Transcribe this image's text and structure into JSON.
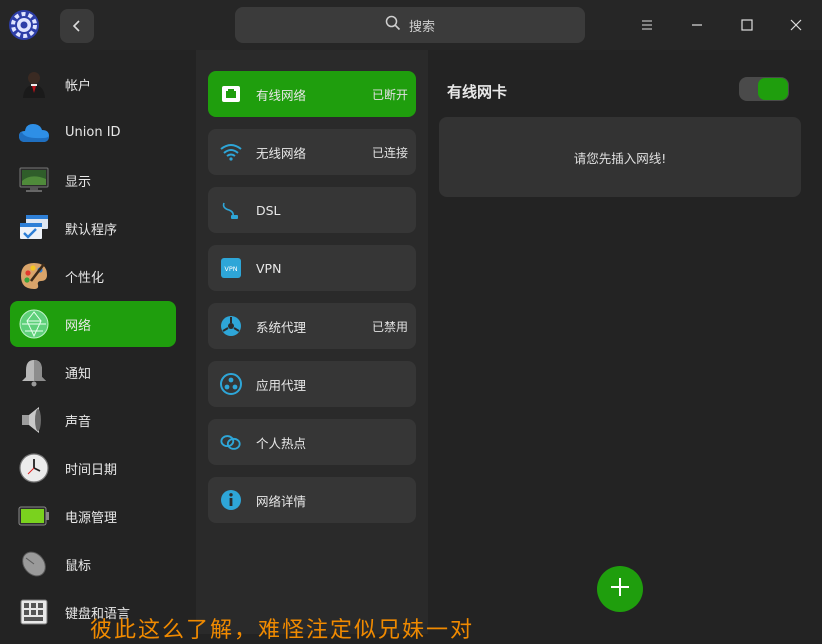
{
  "window": {
    "search_placeholder": "搜索",
    "icons": {
      "logo": "gear-icon",
      "back": "chevron-left-icon",
      "menu": "menu-icon",
      "minimize": "minimize-icon",
      "maximize": "maximize-icon",
      "close": "close-icon"
    }
  },
  "sidebar": {
    "items": [
      {
        "label": "帐户",
        "icon": "user-avatar-icon"
      },
      {
        "label": "Union ID",
        "icon": "cloud-icon"
      },
      {
        "label": "显示",
        "icon": "monitor-icon"
      },
      {
        "label": "默认程序",
        "icon": "default-apps-icon"
      },
      {
        "label": "个性化",
        "icon": "palette-icon"
      },
      {
        "label": "网络",
        "icon": "network-globe-icon",
        "active": true
      },
      {
        "label": "通知",
        "icon": "bell-icon"
      },
      {
        "label": "声音",
        "icon": "speaker-icon"
      },
      {
        "label": "时间日期",
        "icon": "clock-icon"
      },
      {
        "label": "电源管理",
        "icon": "battery-icon"
      },
      {
        "label": "鼠标",
        "icon": "mouse-icon"
      },
      {
        "label": "键盘和语言",
        "icon": "keyboard-icon"
      }
    ]
  },
  "network_menu": {
    "items": [
      {
        "label": "有线网络",
        "status": "已断开",
        "icon": "wired-network-icon",
        "active": true
      },
      {
        "label": "无线网络",
        "status": "已连接",
        "icon": "wifi-icon"
      },
      {
        "label": "DSL",
        "status": "",
        "icon": "dsl-icon"
      },
      {
        "label": "VPN",
        "status": "",
        "icon": "vpn-icon"
      },
      {
        "label": "系统代理",
        "status": "已禁用",
        "icon": "system-proxy-icon"
      },
      {
        "label": "应用代理",
        "status": "",
        "icon": "app-proxy-icon"
      },
      {
        "label": "个人热点",
        "status": "",
        "icon": "hotspot-icon"
      },
      {
        "label": "网络详情",
        "status": "",
        "icon": "info-icon"
      }
    ]
  },
  "wired_panel": {
    "title": "有线网卡",
    "toggle_on": true,
    "notice": "请您先插入网线!",
    "add_icon": "plus-icon"
  },
  "overlay": {
    "subtitle": "彼此这么了解，难怪注定似兄妹一对"
  },
  "colors": {
    "accent": "#1f9e0d",
    "subtitle": "#f08a00"
  }
}
